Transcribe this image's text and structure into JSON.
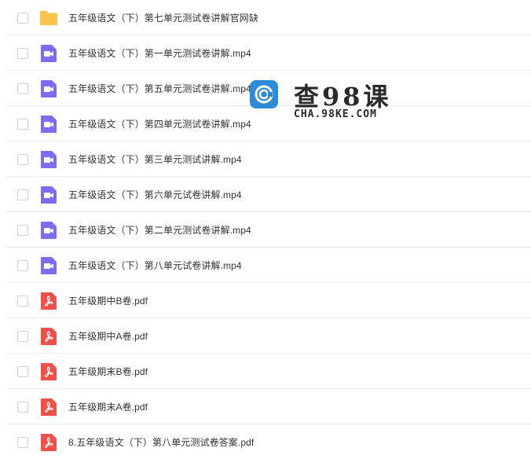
{
  "files": [
    {
      "name": "五年级语文（下）第七单元测试卷讲解官网缺",
      "type": "folder"
    },
    {
      "name": "五年级语文（下）第一单元测试卷讲解.mp4",
      "type": "video"
    },
    {
      "name": "五年级语文（下）第五单元测试卷讲解.mp4",
      "type": "video"
    },
    {
      "name": "五年级语文（下）第四单元测试卷讲解.mp4",
      "type": "video"
    },
    {
      "name": "五年级语文（下）第三单元测试讲解.mp4",
      "type": "video"
    },
    {
      "name": "五年级语文（下）第六单元试卷讲解.mp4",
      "type": "video"
    },
    {
      "name": "五年级语文（下）第二单元测试卷讲解.mp4",
      "type": "video"
    },
    {
      "name": "五年级语文（下）第八单元试卷讲解.mp4",
      "type": "video"
    },
    {
      "name": "五年级期中B卷.pdf",
      "type": "pdf"
    },
    {
      "name": "五年级期中A卷.pdf",
      "type": "pdf"
    },
    {
      "name": "五年级期末B卷.pdf",
      "type": "pdf"
    },
    {
      "name": "五年级期末A卷.pdf",
      "type": "pdf"
    },
    {
      "name": "8.五年级语文（下）第八单元测试卷答案.pdf",
      "type": "pdf"
    }
  ],
  "watermark": {
    "title": "查98课",
    "subtitle": "CHA.98KE.COM"
  },
  "colors": {
    "folder": "#fcc44a",
    "video": "#7b6cf0",
    "pdf": "#f0504a",
    "logo": "#2d8bd8"
  }
}
